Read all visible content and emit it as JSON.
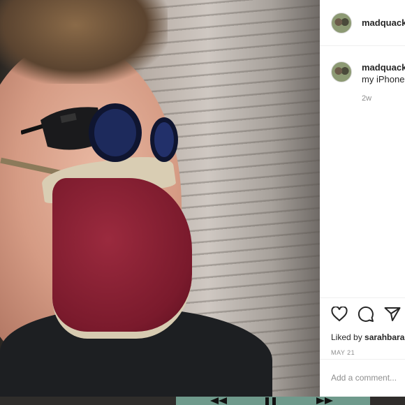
{
  "post": {
    "username": "madquack",
    "caption_username": "madquack",
    "caption_text": "my iPhone",
    "caption_age": "2w",
    "liked_by_prefix": "Liked by ",
    "liked_by_user": "sarahbara",
    "date": "MAY 21",
    "comment_placeholder": "Add a comment..."
  },
  "colors": {
    "mask": "#7a1a2c",
    "panel_bg": "#ffffff",
    "muted_text": "#8e8e8e",
    "player_bar": "#6f9a8c"
  },
  "icons": {
    "like": "heart-icon",
    "comment": "comment-bubble-icon",
    "share": "paper-plane-icon",
    "rewind": "rewind-icon",
    "pause": "pause-icon",
    "fast_forward": "fast-forward-icon"
  }
}
